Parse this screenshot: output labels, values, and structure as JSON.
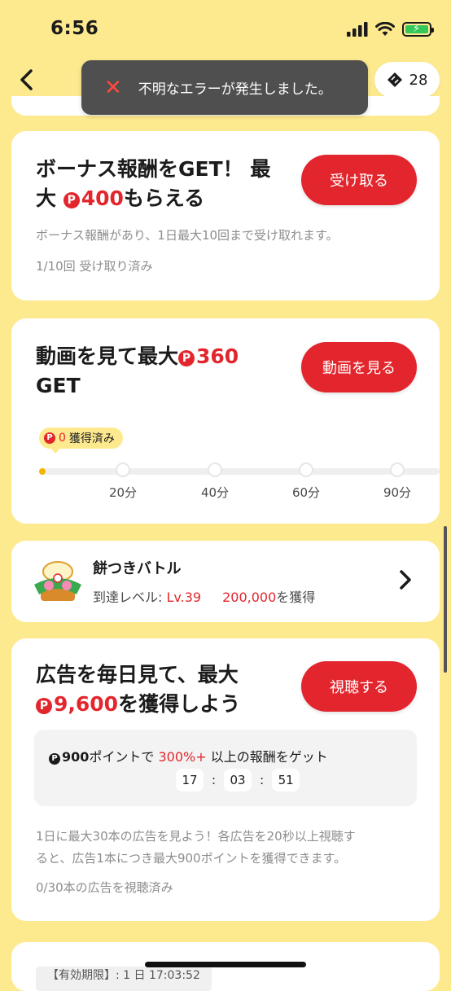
{
  "status_bar": {
    "time": "6:56"
  },
  "header": {
    "toast_text": "不明なエラーが発生しました。",
    "ticket_count": "28"
  },
  "bonus_card": {
    "title_line1": "ボーナス報酬をGET！ 最",
    "title_line2_prefix": "大 ",
    "title_amount": "400",
    "title_line2_suffix": "もらえる",
    "button": "受け取る",
    "description": "ボーナス報酬があり、1日最大10回まで受け取れます。",
    "progress": "1/10回 受け取り済み"
  },
  "video_card": {
    "title_prefix": "動画を見て最大",
    "title_amount": "360",
    "title_line2": "GET",
    "button": "動画を見る",
    "earned_amount": "0",
    "earned_label": "獲得済み",
    "progress_fraction": 0,
    "milestones": [
      "20分",
      "40分",
      "60分",
      "90分"
    ]
  },
  "mochi_card": {
    "title": "餅つきバトル",
    "level_label": "到達レベル: ",
    "level_value": "Lv.39",
    "reward_amount": "200,000",
    "reward_suffix": "を獲得"
  },
  "ad_card": {
    "title_line1": "広告を毎日見て、最大",
    "title_amount": "9,600",
    "title_line2_suffix": "を獲得しよう",
    "button": "視聴する",
    "promo_points": "900",
    "promo_mid": "ポイントで ",
    "promo_percent": "300%+",
    "promo_suffix": " 以上の報酬をゲット",
    "timer": {
      "h": "17",
      "m": "03",
      "s": "51",
      "sep": ":"
    },
    "description_line1": "1日に最大30本の広告を見よう！各広告を20秒以上視聴す",
    "description_line2": "ると、広告1本につき最大900ポイントを獲得できます。",
    "progress": "0/30本の広告を視聴済み"
  },
  "bottom_card": {
    "validity_text": "【有効期限】: 1 日 17:03:52"
  },
  "icons": {
    "coin": "P"
  }
}
